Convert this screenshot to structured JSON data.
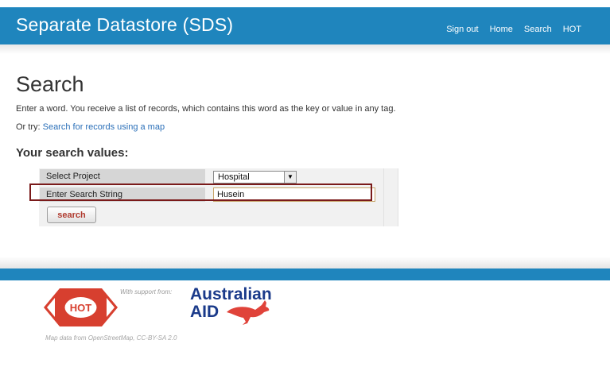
{
  "header": {
    "title": "Separate Datastore (SDS)",
    "nav": [
      "Sign out",
      "Home",
      "Search",
      "HOT"
    ]
  },
  "main": {
    "title": "Search",
    "intro": "Enter a word. You receive a list of records, which contains this word as the key or value in any tag.",
    "or_try_prefix": "Or try: ",
    "map_link": "Search for records using a map",
    "form_heading": "Your search values:",
    "fields": {
      "project_label": "Select Project",
      "project_value": "Hospital",
      "search_label": "Enter Search String",
      "search_value": "Husein"
    },
    "search_button": "search"
  },
  "footer": {
    "hot_logo_text": "HOT",
    "support_text": "With support from:",
    "aid_line1": "Australian",
    "aid_line2": "AID",
    "map_credit": "Map data from OpenStreetMap, CC-BY-SA 2.0"
  },
  "colors": {
    "header_blue": "#1f85bd",
    "hot_red": "#d73f2f",
    "aid_blue": "#1a3a8a",
    "highlight_border": "#7a1a1a"
  }
}
